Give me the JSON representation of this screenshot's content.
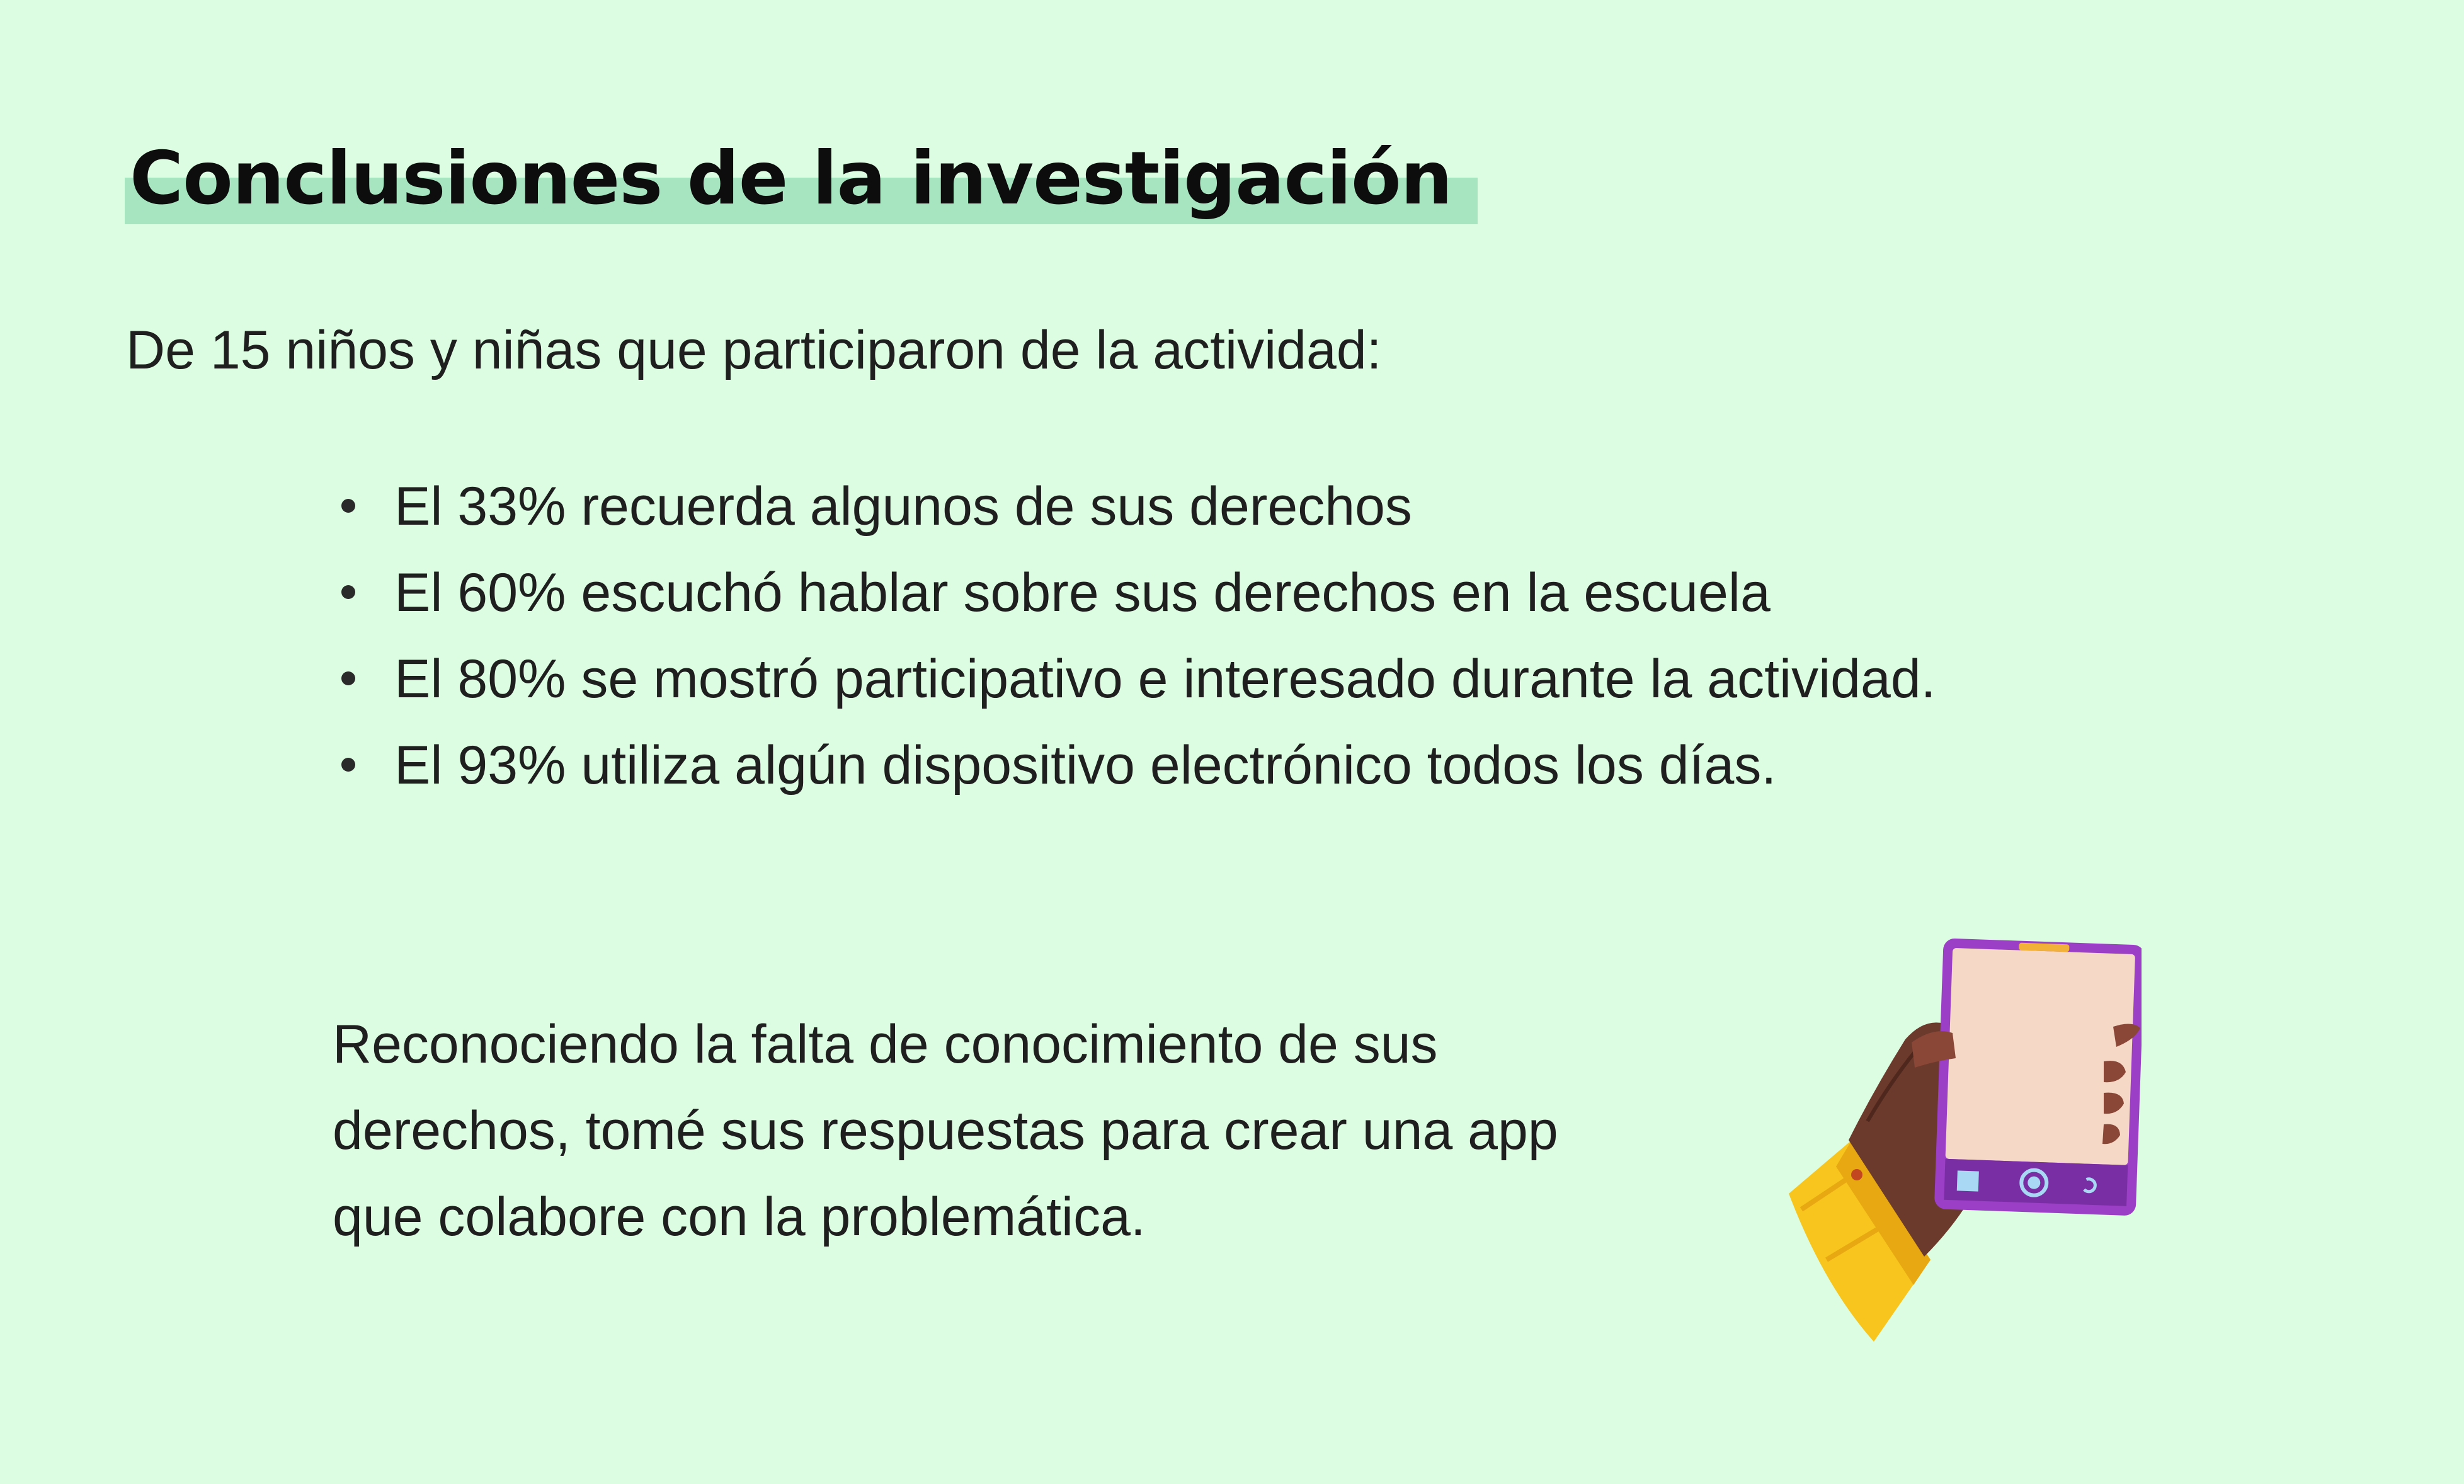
{
  "title": "Conclusiones de la investigación",
  "intro": "De 15 niños y niñas que participaron de la actividad:",
  "bullets": [
    "El 33% recuerda algunos de sus derechos",
    "El 60% escuchó hablar sobre sus derechos en la escuela",
    "El 80% se mostró participativo e interesado durante la actividad.",
    "El 93% utiliza algún dispositivo electrónico todos los días."
  ],
  "closing_lines": [
    "Reconociendo la falta de conocimiento de sus",
    "derechos, tomé sus respuestas para crear una app",
    "que colabore con la problemática."
  ],
  "colors": {
    "background": "#dcfde2",
    "title_highlight": "#a6e5c0",
    "phone_frame": "#9b3fc6",
    "phone_screen": "#f6d8c6",
    "sleeve": "#f7c51e",
    "skin": "#6b3a2c"
  },
  "illustration": {
    "icon": "hand-holding-phone-icon"
  }
}
